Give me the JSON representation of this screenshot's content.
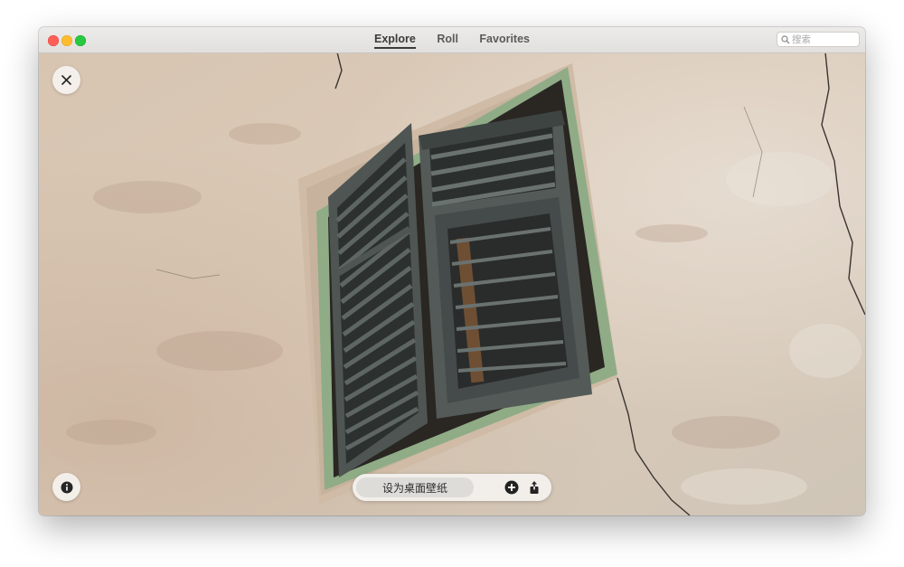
{
  "window": {
    "tabs": [
      {
        "label": "Explore",
        "active": true
      },
      {
        "label": "Roll",
        "active": false
      },
      {
        "label": "Favorites",
        "active": false
      }
    ],
    "search": {
      "placeholder": "搜索",
      "value": ""
    }
  },
  "photo": {
    "subject": "Green wooden louvered window shutters on a weathered stucco wall"
  },
  "controls": {
    "close_icon": "close-icon",
    "info_icon": "info-icon",
    "set_wallpaper_label": "设为桌面壁纸",
    "add_icon": "plus-circle-icon",
    "share_icon": "share-icon"
  },
  "colors": {
    "close": "#fe5f57",
    "minimize": "#febc2e",
    "maximize": "#28c840",
    "wall": "#d8c9b8",
    "shutter": "#4e5553",
    "frame_green": "#8fac86"
  }
}
